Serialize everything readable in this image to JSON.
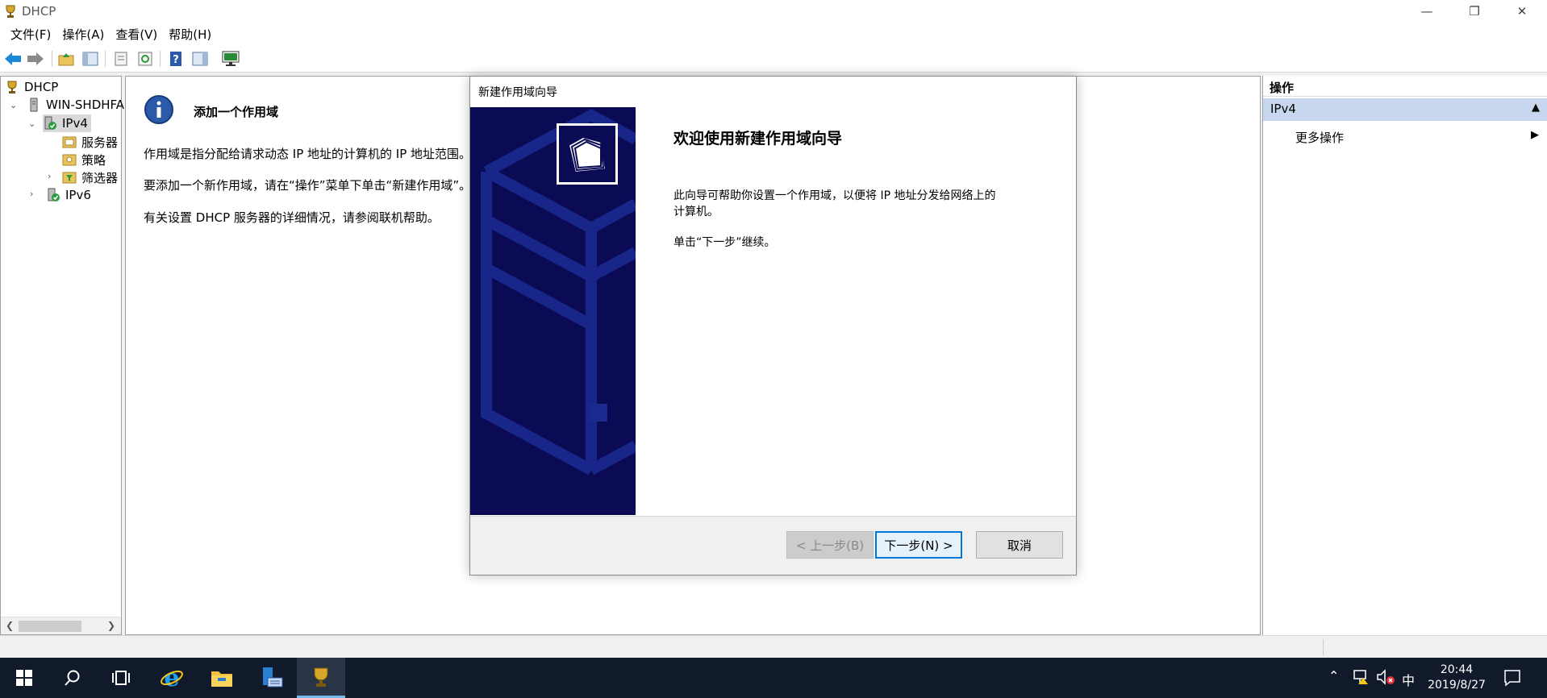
{
  "window": {
    "title": "DHCP",
    "icon": "dhcp-trophy-icon",
    "controls": [
      "minimize-icon",
      "restore-icon",
      "close-icon"
    ]
  },
  "menu": [
    {
      "label": "文件(F)"
    },
    {
      "label": "操作(A)"
    },
    {
      "label": "查看(V)"
    },
    {
      "label": "帮助(H)"
    }
  ],
  "toolbar": {
    "buttons": [
      "back-arrow-icon",
      "forward-arrow-icon",
      "up-folder-icon",
      "show-hide-tree-icon",
      "properties-icon",
      "refresh-icon",
      "help-icon",
      "show-hide-action-pane-icon",
      "monitor-icon"
    ]
  },
  "tree": {
    "root": "DHCP",
    "server": "WIN-SHDHFA",
    "ipv4": "IPv4",
    "server_options": "服务器",
    "policies": "策略",
    "filters": "筛选器",
    "ipv6": "IPv6"
  },
  "center": {
    "header": "添加一个作用域",
    "line1": "作用域是指分配给请求动态 IP 地址的计算机的 IP 地址范围。",
    "line2": "要添加一个新作用域，请在“操作”菜单下单击“新建作用域”。",
    "line3": "有关设置 DHCP 服务器的详细情况，请参阅联机帮助。"
  },
  "actions": {
    "header": "操作",
    "section": "IPv4",
    "more": "更多操作"
  },
  "wizard": {
    "title": "新建作用域向导",
    "heading": "欢迎使用新建作用域向导",
    "desc1": "此向导可帮助你设置一个作用域，以便将 IP 地址分发给网络上的",
    "desc2": "计算机。",
    "desc3": "单击“下一步”继续。",
    "back_label": "< 上一步(B)",
    "next_label": "下一步(N) >",
    "cancel_label": "取消"
  },
  "taskbar": {
    "apps": [
      "windows-start-icon",
      "search-icon",
      "task-view-icon",
      "internet-explorer-icon",
      "file-explorer-icon",
      "server-manager-icon",
      "dhcp-app-icon"
    ],
    "ime": "中",
    "time": "20:44",
    "date": "2019/8/27"
  },
  "colors": {
    "banner": "#0b0b55",
    "selection": "#c7d8ee",
    "taskbar": "#101a2b",
    "accent": "#0078d7"
  }
}
